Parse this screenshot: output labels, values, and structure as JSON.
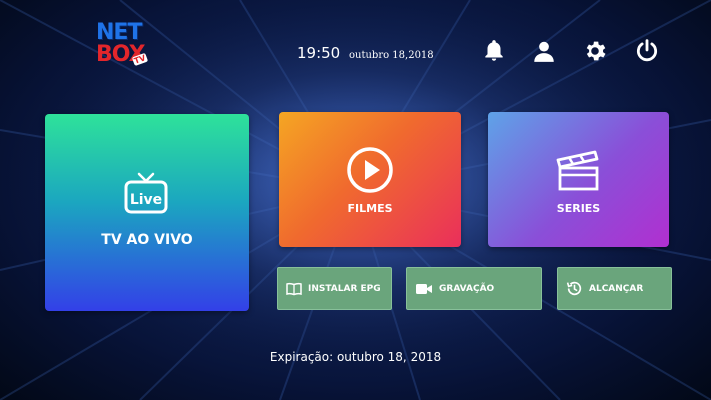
{
  "brand": {
    "line1": "NET",
    "line2": "BOX",
    "badge": "TV"
  },
  "header": {
    "time": "19:50",
    "date": "outubro 18,2018",
    "icons": [
      "bell-icon",
      "user-icon",
      "gear-icon",
      "power-icon"
    ]
  },
  "tiles": {
    "live": {
      "icon_text": "Live",
      "label": "TV AO VIVO"
    },
    "filmes": {
      "label": "FILMES"
    },
    "series": {
      "label": "SERIES"
    }
  },
  "buttons": {
    "epg": {
      "label": "INSTALAR EPG"
    },
    "gravacao": {
      "label": "GRAVAÇÃO"
    },
    "alcancar": {
      "label": "ALCANÇAR"
    }
  },
  "footer": {
    "expiry": "Expiração: outubro 18, 2018"
  },
  "colors": {
    "button_green": "#6aa57c",
    "brand_blue": "#1f73e8",
    "brand_red": "#e3262b"
  }
}
